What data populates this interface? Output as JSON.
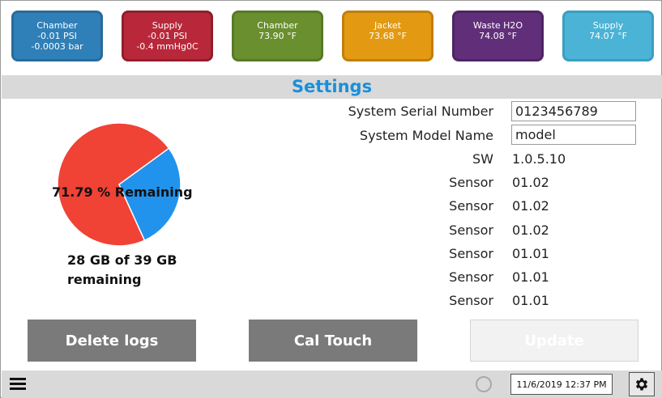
{
  "tiles": [
    {
      "name": "Chamber",
      "line1": "-0.01 PSI",
      "line2": "-0.0003 bar",
      "bg": "#2f7fb8",
      "border": "#2a6b9a"
    },
    {
      "name": "Supply",
      "line1": "-0.01 PSI",
      "line2": "-0.4 mmHg0C",
      "bg": "#b8283a",
      "border": "#8f1f2c"
    },
    {
      "name": "Chamber",
      "line1": "73.90 °F",
      "line2": "",
      "bg": "#6a8f2f",
      "border": "#587a26"
    },
    {
      "name": "Jacket",
      "line1": "73.68 °F",
      "line2": "",
      "bg": "#e39a12",
      "border": "#c07f0c"
    },
    {
      "name": "Waste H2O",
      "line1": "74.08 °F",
      "line2": "",
      "bg": "#612f7a",
      "border": "#4e2563"
    },
    {
      "name": "Supply",
      "line1": "74.07 °F",
      "line2": "",
      "bg": "#4ab3d6",
      "border": "#3a9fc1"
    }
  ],
  "settings": {
    "title": "Settings"
  },
  "storage": {
    "pie_label": "71.79 % Remaining",
    "remaining_fraction": 0.7179,
    "summary": "28 GB of 39 GB remaining",
    "colors": {
      "remaining": "#f04235",
      "used": "#2293ec"
    }
  },
  "system": {
    "serial_label": "System Serial Number",
    "serial_value": "0123456789",
    "model_label": "System Model Name",
    "model_value": "model",
    "sw_label": "SW",
    "sw_value": "1.0.5.10",
    "sensors": [
      {
        "label": "Sensor",
        "value": "01.02"
      },
      {
        "label": "Sensor",
        "value": "01.02"
      },
      {
        "label": "Sensor",
        "value": "01.02"
      },
      {
        "label": "Sensor",
        "value": "01.01"
      },
      {
        "label": "Sensor",
        "value": "01.01"
      },
      {
        "label": "Sensor",
        "value": "01.01"
      }
    ]
  },
  "buttons": {
    "delete_logs": "Delete logs",
    "cal_touch": "Cal Touch",
    "update": "Update"
  },
  "status_bar": {
    "datetime": "11/6/2019 12:37 PM",
    "menu_icon": "hamburger-menu-icon",
    "settings_icon": "gear-icon",
    "status_icon": "status-circle-icon"
  }
}
